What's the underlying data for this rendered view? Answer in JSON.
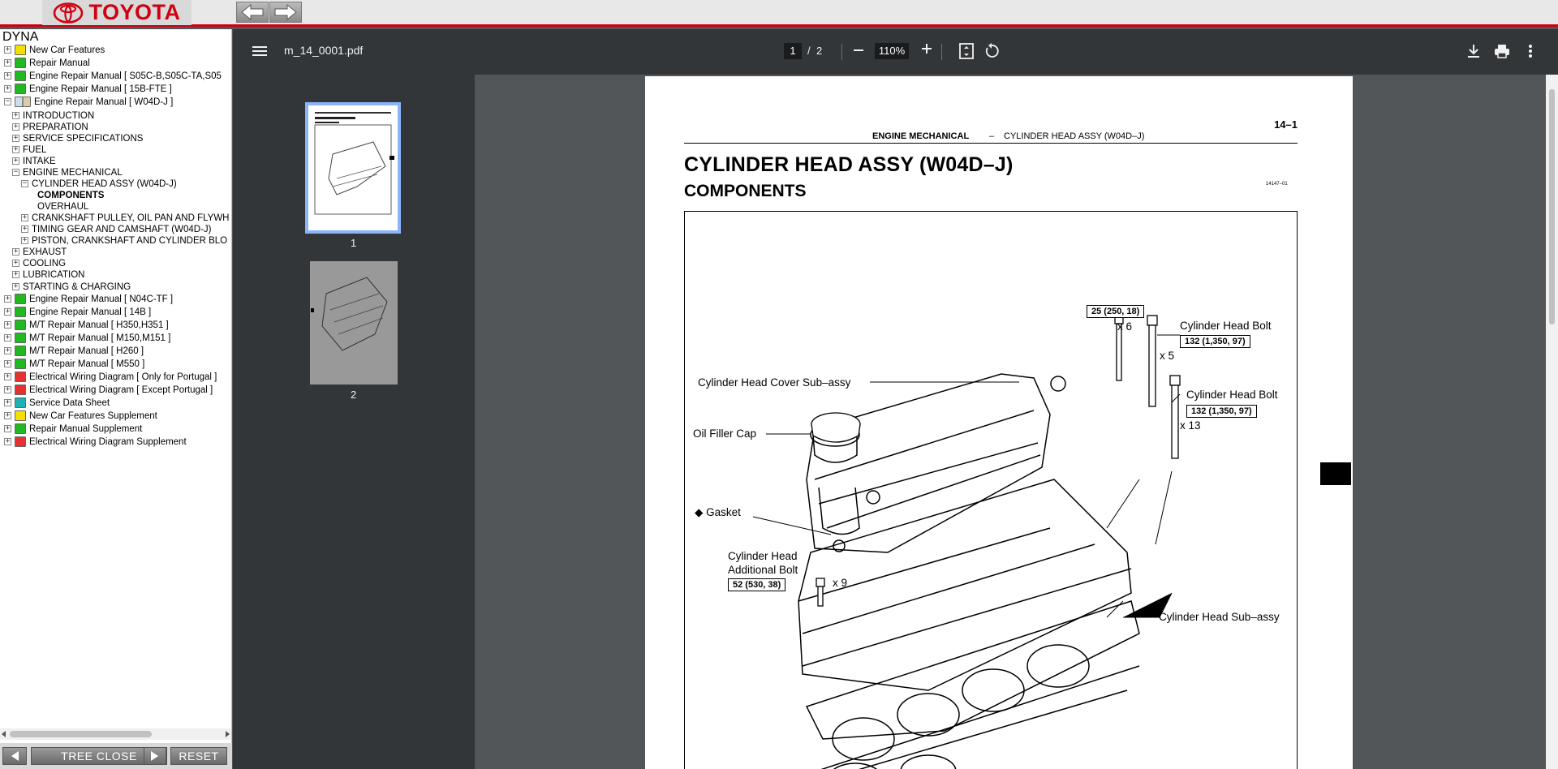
{
  "header": {
    "logo_text": "TOYOTA"
  },
  "tree": {
    "root_label": "DYNA",
    "items": [
      {
        "label": "New Car Features",
        "indent": 0,
        "expander": "+",
        "color": "#f3e000"
      },
      {
        "label": "Repair Manual",
        "indent": 0,
        "expander": "+",
        "color": "#21b821"
      },
      {
        "label": "Engine Repair Manual [ S05C-B,S05C-TA,S05",
        "indent": 0,
        "expander": "+",
        "color": "#21b821"
      },
      {
        "label": "Engine Repair Manual [ 15B-FTE ]",
        "indent": 0,
        "expander": "+",
        "color": "#21b821"
      },
      {
        "label": "Engine Repair Manual [ W04D-J ]",
        "indent": 0,
        "expander": "−",
        "color": "open"
      },
      {
        "label": "INTRODUCTION",
        "indent": 1,
        "expander": "+"
      },
      {
        "label": "PREPARATION",
        "indent": 1,
        "expander": "+"
      },
      {
        "label": "SERVICE SPECIFICATIONS",
        "indent": 1,
        "expander": "+"
      },
      {
        "label": "FUEL",
        "indent": 1,
        "expander": "+"
      },
      {
        "label": "INTAKE",
        "indent": 1,
        "expander": "+"
      },
      {
        "label": "ENGINE MECHANICAL",
        "indent": 1,
        "expander": "−"
      },
      {
        "label": "CYLINDER HEAD ASSY (W04D-J)",
        "indent": 2,
        "expander": "−"
      },
      {
        "label": "COMPONENTS",
        "indent": 3,
        "expander": "",
        "bold": true
      },
      {
        "label": "OVERHAUL",
        "indent": 3,
        "expander": ""
      },
      {
        "label": "CRANKSHAFT PULLEY, OIL PAN AND FLYWH",
        "indent": 2,
        "expander": "+"
      },
      {
        "label": "TIMING GEAR AND CAMSHAFT (W04D-J)",
        "indent": 2,
        "expander": "+"
      },
      {
        "label": "PISTON, CRANKSHAFT AND CYLINDER BLO",
        "indent": 2,
        "expander": "+"
      },
      {
        "label": "EXHAUST",
        "indent": 1,
        "expander": "+"
      },
      {
        "label": "COOLING",
        "indent": 1,
        "expander": "+"
      },
      {
        "label": "LUBRICATION",
        "indent": 1,
        "expander": "+"
      },
      {
        "label": "STARTING & CHARGING",
        "indent": 1,
        "expander": "+"
      },
      {
        "label": "Engine Repair Manual [ N04C-TF ]",
        "indent": 0,
        "expander": "+",
        "color": "#21b821"
      },
      {
        "label": "Engine Repair Manual [ 14B ]",
        "indent": 0,
        "expander": "+",
        "color": "#21b821"
      },
      {
        "label": "M/T Repair Manual [ H350,H351 ]",
        "indent": 0,
        "expander": "+",
        "color": "#21b821"
      },
      {
        "label": "M/T Repair Manual [ M150,M151 ]",
        "indent": 0,
        "expander": "+",
        "color": "#21b821"
      },
      {
        "label": "M/T Repair Manual [ H260 ]",
        "indent": 0,
        "expander": "+",
        "color": "#21b821"
      },
      {
        "label": "M/T Repair Manual [ M550 ]",
        "indent": 0,
        "expander": "+",
        "color": "#21b821"
      },
      {
        "label": "Electrical Wiring Diagram [ Only for Portugal ]",
        "indent": 0,
        "expander": "+",
        "color": "#e83030"
      },
      {
        "label": "Electrical Wiring Diagram [ Except Portugal ]",
        "indent": 0,
        "expander": "+",
        "color": "#e83030"
      },
      {
        "label": "Service Data Sheet",
        "indent": 0,
        "expander": "+",
        "color": "#20b0b0"
      },
      {
        "label": "New Car Features Supplement",
        "indent": 0,
        "expander": "+",
        "color": "#f3e000"
      },
      {
        "label": "Repair Manual Supplement",
        "indent": 0,
        "expander": "+",
        "color": "#21b821"
      },
      {
        "label": "Electrical Wiring Diagram Supplement",
        "indent": 0,
        "expander": "+",
        "color": "#e83030"
      }
    ]
  },
  "bottom": {
    "tree_close": "TREE CLOSE",
    "reset": "RESET"
  },
  "viewer": {
    "file_name": "m_14_0001.pdf",
    "current_page": "1",
    "page_separator": "/",
    "total_pages": "2",
    "zoom": "110%",
    "thumbnails": [
      {
        "label": "1"
      },
      {
        "label": "2"
      }
    ]
  },
  "document": {
    "page_number": "14–1",
    "header_left": "ENGINE MECHANICAL",
    "header_dash": "–",
    "header_right": "CYLINDER HEAD ASSY (W04D–J)",
    "title": "CYLINDER HEAD ASSY (W04D–J)",
    "subtitle": "COMPONENTS",
    "code": "14147–01",
    "labels": {
      "head_bolt_1": "Cylinder Head  Bolt",
      "head_bolt_2": "Cylinder Head  Bolt",
      "cover": "Cylinder Head Cover Sub–assy",
      "filler": "Oil Filler Cap",
      "gasket": "◆ Gasket",
      "additional_1": "Cylinder Head",
      "additional_2": "Additional Bolt",
      "sub_assy": "Cylinder Head Sub–assy",
      "x6": "x 6",
      "x5": "x 5",
      "x13": "x 13",
      "x9": "x 9"
    },
    "torques": {
      "t1": "25 (250, 18)",
      "t2": "132 (1,350, 97)",
      "t3": "132 (1,350, 97)",
      "t4": "52 (530, 38)"
    }
  }
}
